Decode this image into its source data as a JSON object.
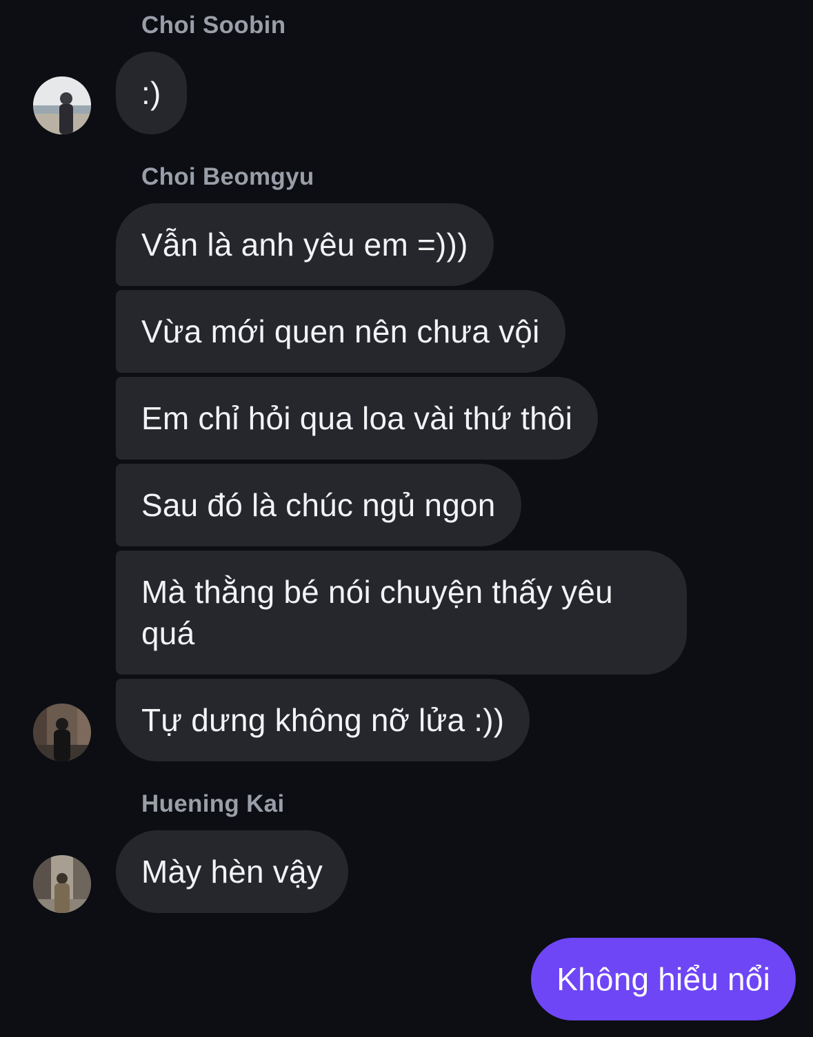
{
  "conversation": {
    "groups": [
      {
        "sender": "Choi Soobin",
        "avatar_icon": "user-photo-beach",
        "messages": [
          ":)"
        ]
      },
      {
        "sender": "Choi Beomgyu",
        "avatar_icon": "user-photo-street",
        "messages": [
          "Vẫn là anh yêu em =)))",
          "Vừa mới quen nên chưa vội",
          "Em chỉ hỏi qua loa vài thứ thôi",
          "Sau đó là chúc ngủ ngon",
          "Mà thằng bé nói chuyện thấy yêu quá",
          "Tự dưng không nỡ lửa :))"
        ]
      },
      {
        "sender": "Huening Kai",
        "avatar_icon": "user-photo-city",
        "messages": [
          "Mày hèn vậy"
        ]
      }
    ],
    "outgoing": {
      "messages": [
        "Không hiểu nổi"
      ]
    }
  },
  "colors": {
    "background": "#0c0e13",
    "incoming_bubble": "#25272d",
    "outgoing_bubble": "#6e46f6",
    "sender_name": "#9a9ea8",
    "message_text": "#f2f3f5"
  }
}
